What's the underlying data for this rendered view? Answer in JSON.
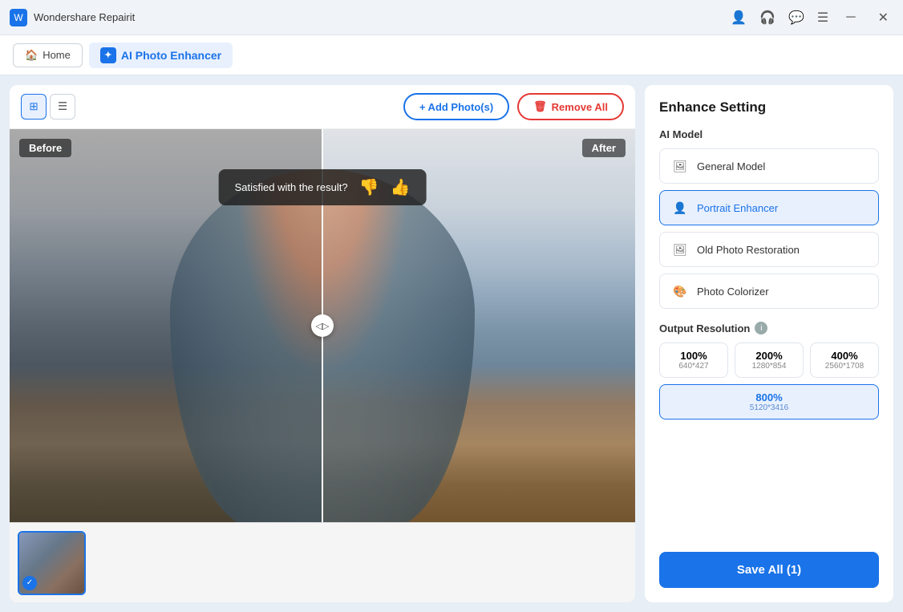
{
  "titlebar": {
    "app_name": "Wondershare Repairit",
    "icons": [
      "account",
      "headset",
      "chat",
      "menu",
      "minimize",
      "close"
    ]
  },
  "navbar": {
    "home_label": "Home",
    "active_tab_label": "AI Photo Enhancer"
  },
  "toolbar": {
    "add_photos_label": "+ Add Photo(s)",
    "remove_all_label": "Remove All"
  },
  "photo_viewer": {
    "before_label": "Before",
    "after_label": "After",
    "satisfaction_text": "Satisfied with the result?",
    "thumbs_up": "👍",
    "thumbs_down": "👎"
  },
  "right_panel": {
    "title": "Enhance Setting",
    "ai_model_label": "AI Model",
    "models": [
      {
        "id": "general",
        "label": "General Model",
        "active": false
      },
      {
        "id": "portrait",
        "label": "Portrait Enhancer",
        "active": true
      },
      {
        "id": "old_photo",
        "label": "Old Photo Restoration",
        "active": false
      },
      {
        "id": "colorizer",
        "label": "Photo Colorizer",
        "active": false
      }
    ],
    "resolution_label": "Output Resolution",
    "resolutions": [
      {
        "pct": "100%",
        "dims": "640*427",
        "active": false
      },
      {
        "pct": "200%",
        "dims": "1280*854",
        "active": false
      },
      {
        "pct": "400%",
        "dims": "2560*1708",
        "active": false
      },
      {
        "pct": "800%",
        "dims": "5120*3416",
        "active": true
      }
    ],
    "save_label": "Save All (1)"
  }
}
